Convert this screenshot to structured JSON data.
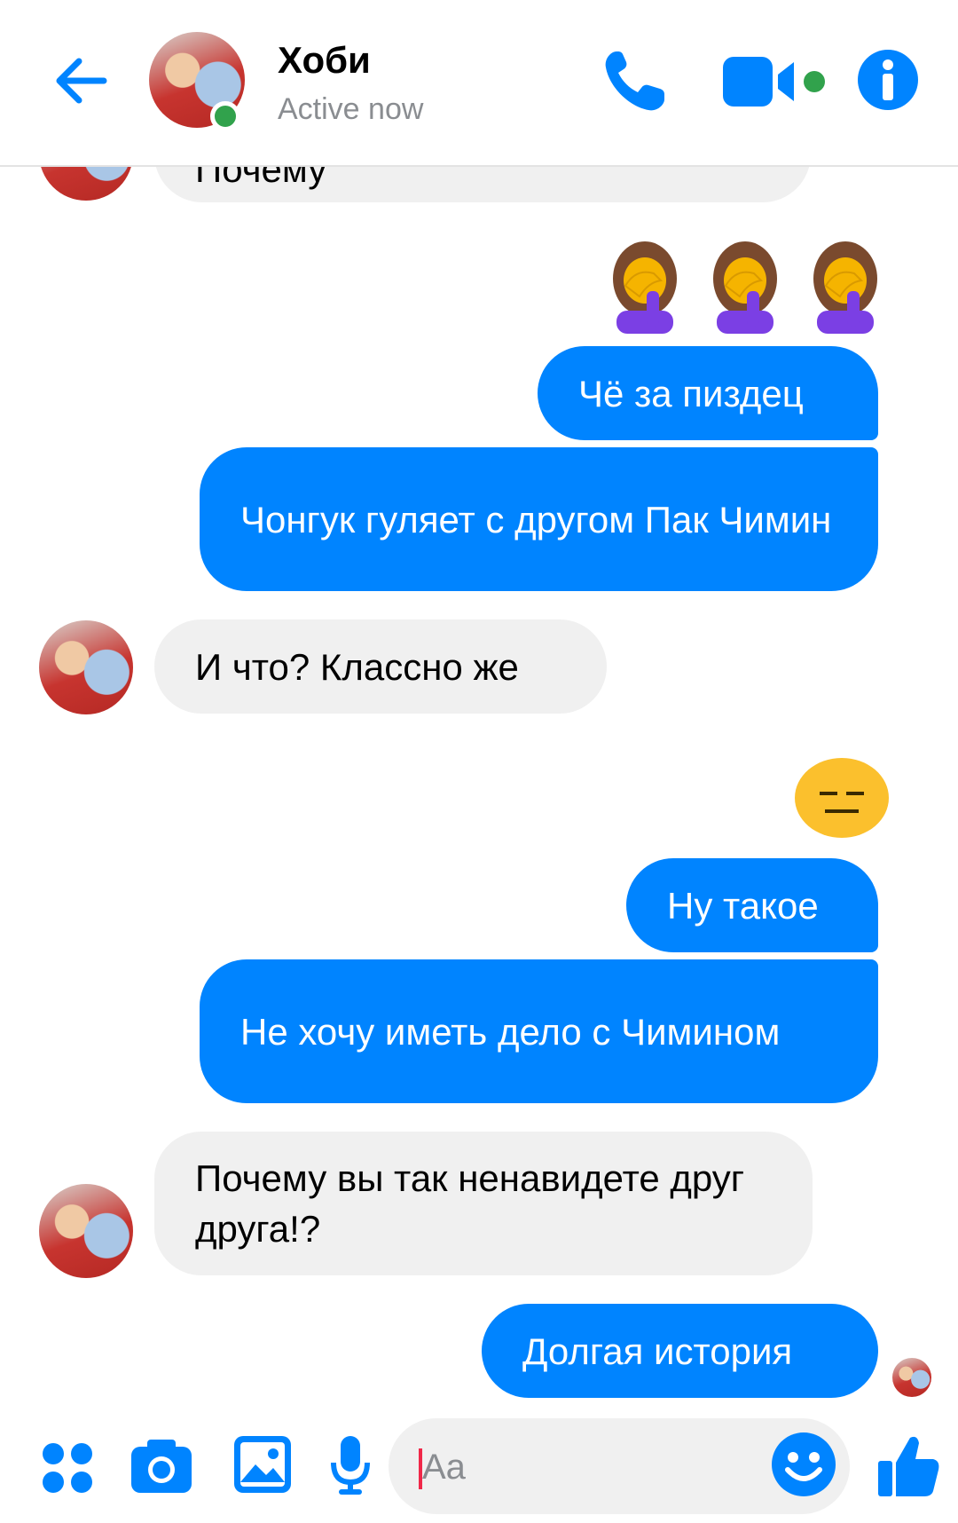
{
  "header": {
    "contact_name": "Хоби",
    "status": "Active now",
    "icons": [
      "back-arrow-icon",
      "phone-icon",
      "video-camera-icon",
      "info-icon"
    ]
  },
  "colors": {
    "accent": "#0084ff",
    "incoming_bubble": "#f0f0f0",
    "online": "#31a24c",
    "muted_text": "#8a8d91"
  },
  "messages": {
    "partial_top": "Почему",
    "m1": "Чё за пиздец",
    "m2": "Чонгук гуляет с другом Пак Чимин",
    "m3": "И что? Классно же",
    "m4": "Ну такое",
    "m5": "Не хочу иметь дело с Чимином",
    "m6": "Почему вы так ненавидете друг друга!?",
    "m7": "Долгая история"
  },
  "emoji": {
    "facepalm": "person-facepalming",
    "neutral": "expressionless-face"
  },
  "composer": {
    "placeholder": "Aa",
    "icons": [
      "apps-icon",
      "camera-icon",
      "gallery-icon",
      "microphone-icon",
      "emoji-icon",
      "like-icon"
    ]
  }
}
